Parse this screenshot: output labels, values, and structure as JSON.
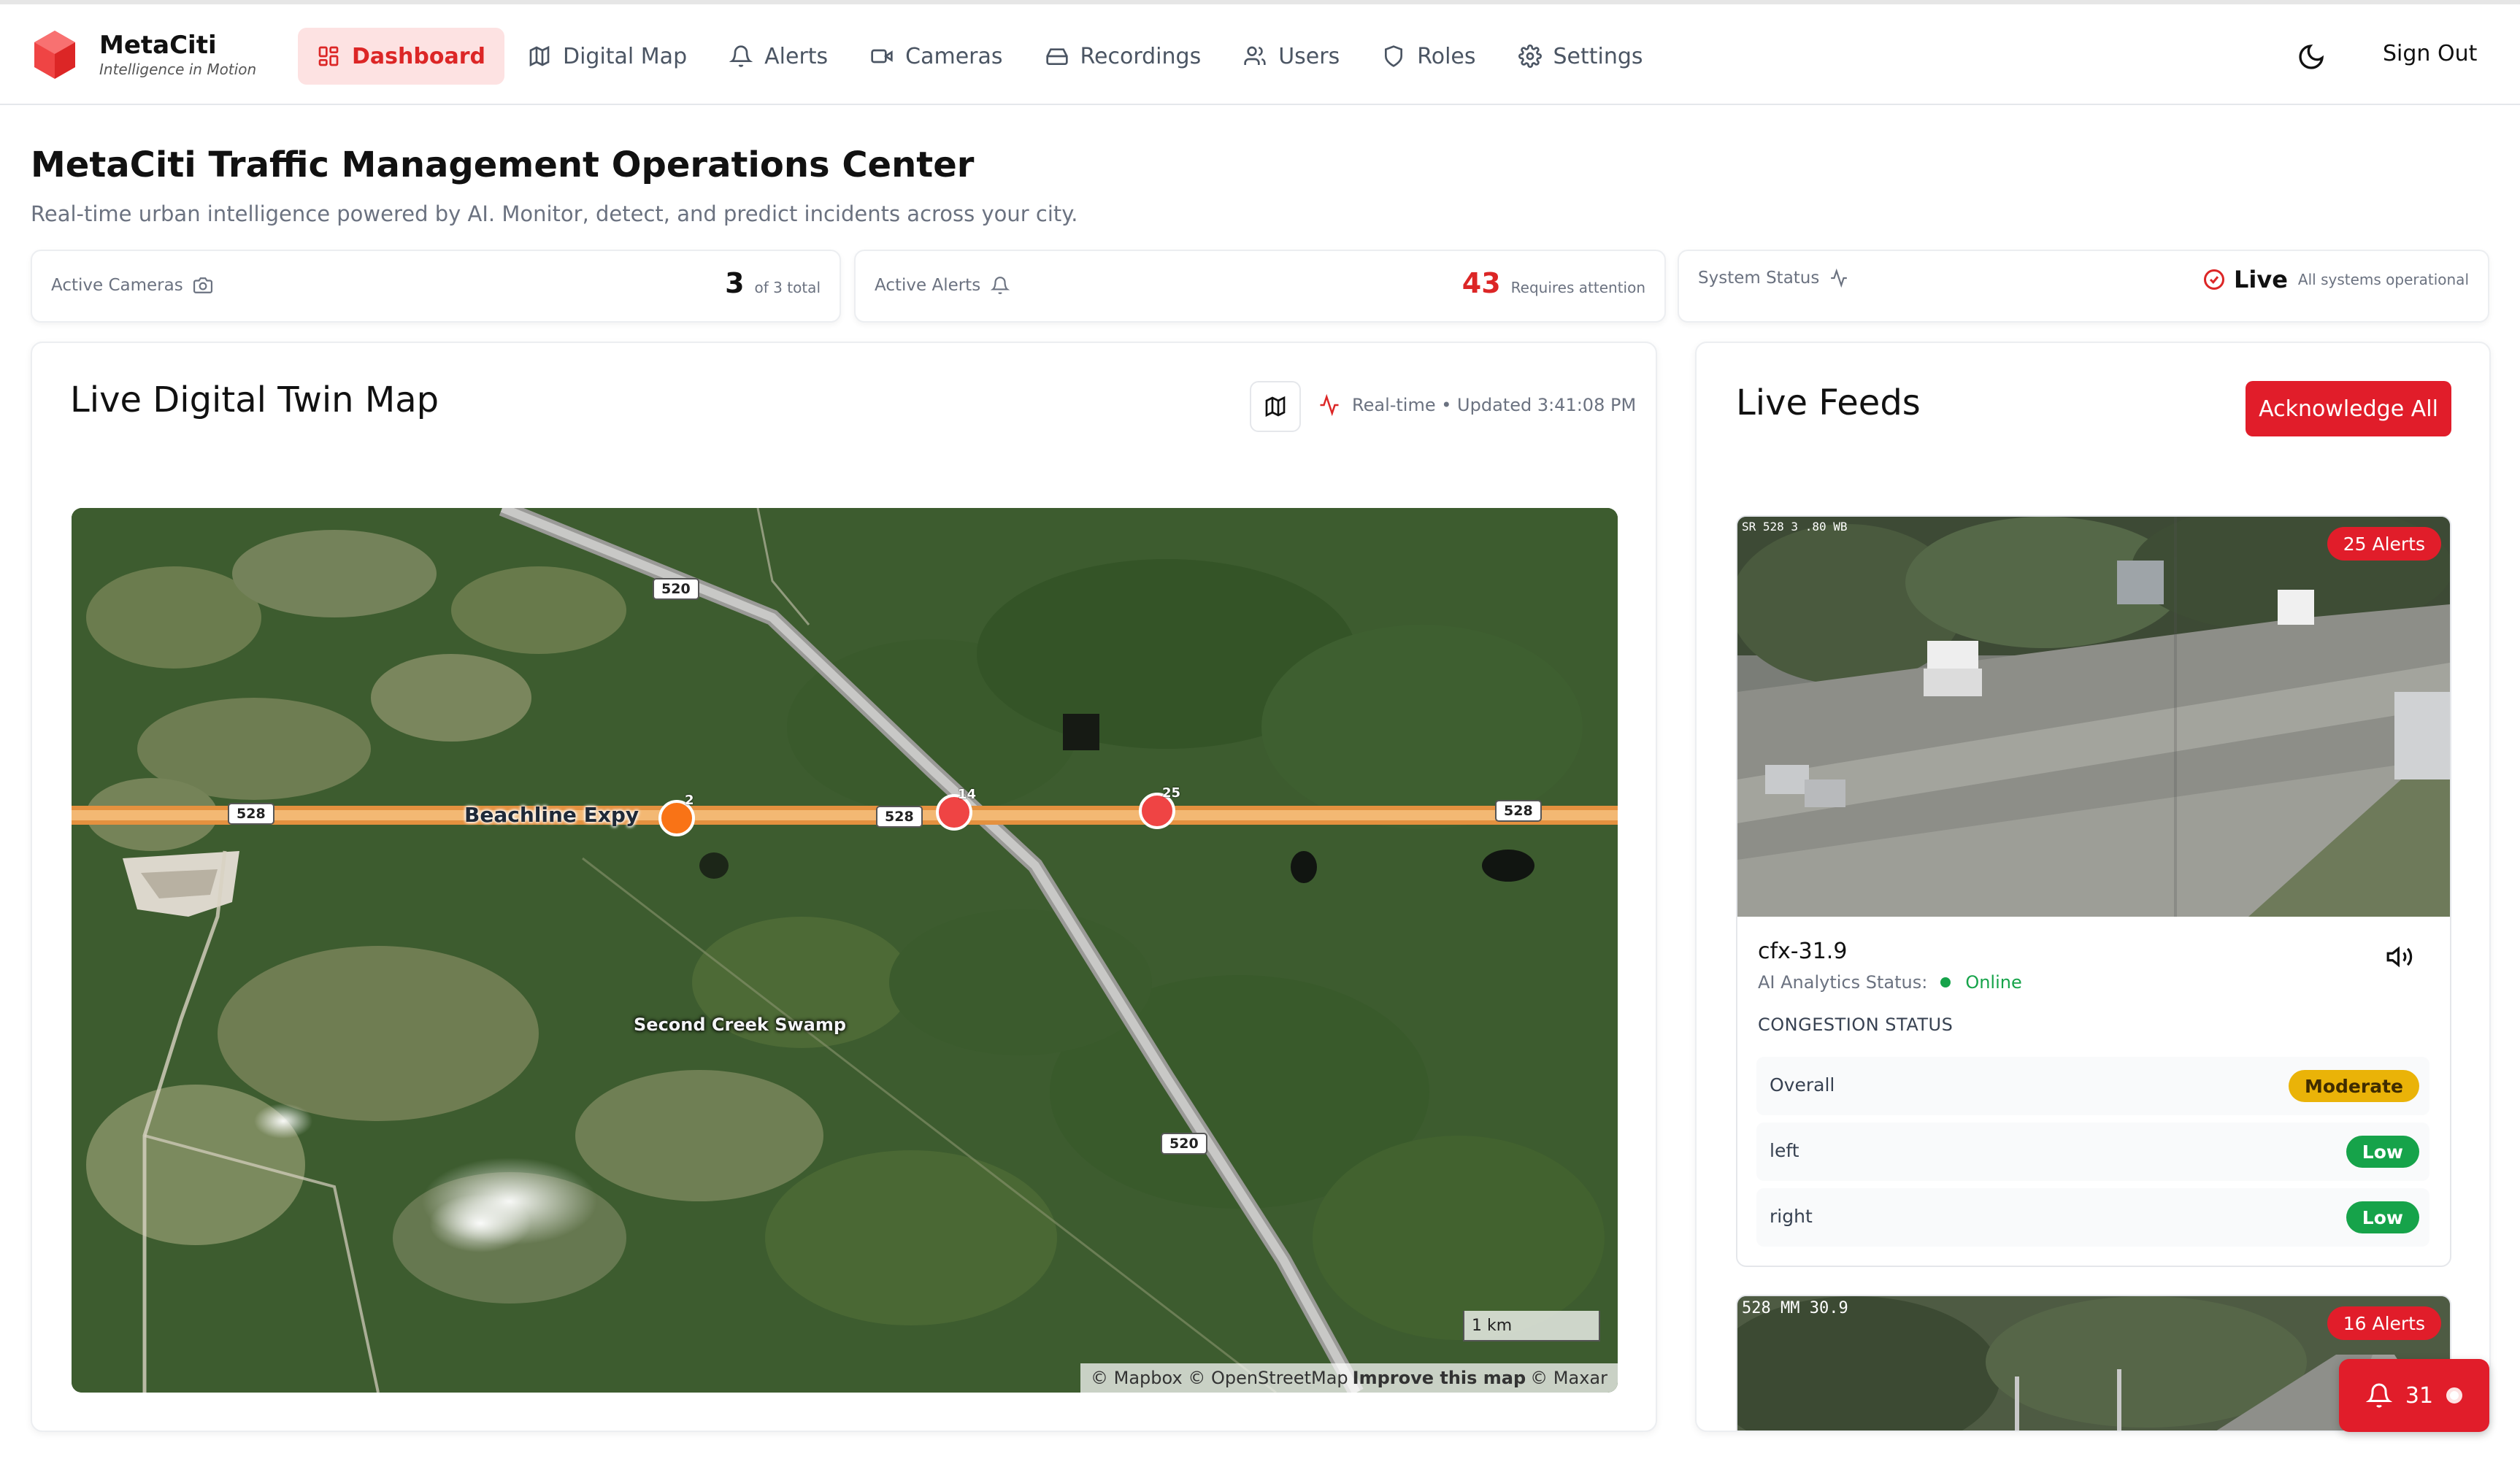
{
  "app": {
    "name": "MetaCiti",
    "tagline": "Intelligence in Motion",
    "brand_color": "#dc2626"
  },
  "nav": {
    "items": [
      {
        "label": "Dashboard",
        "icon": "dashboard-icon",
        "active": true
      },
      {
        "label": "Digital Map",
        "icon": "map-icon"
      },
      {
        "label": "Alerts",
        "icon": "bell-icon"
      },
      {
        "label": "Cameras",
        "icon": "video-icon"
      },
      {
        "label": "Recordings",
        "icon": "hard-drive-icon"
      },
      {
        "label": "Users",
        "icon": "users-icon"
      },
      {
        "label": "Roles",
        "icon": "shield-icon"
      },
      {
        "label": "Settings",
        "icon": "gear-icon"
      }
    ],
    "theme_icon": "moon-icon",
    "sign_out": "Sign Out"
  },
  "header": {
    "title": "MetaCiti Traffic Management Operations Center",
    "subtitle": "Real-time urban intelligence powered by AI. Monitor, detect, and predict incidents across your city."
  },
  "stats": {
    "cameras": {
      "label": "Active Cameras",
      "value": "3",
      "sub": "of 3 total"
    },
    "alerts": {
      "label": "Active Alerts",
      "value": "43",
      "sub": "Requires attention"
    },
    "system": {
      "label": "System Status",
      "value": "Live",
      "sub": "All systems operational"
    }
  },
  "map": {
    "title": "Live Digital Twin Map",
    "status": "Real-time • Updated 3:41:08 PM",
    "road_name": "Beachline Expy",
    "place_name": "Second Creek Swamp",
    "route_shields": [
      "528",
      "528",
      "528",
      "520",
      "520"
    ],
    "markers": [
      {
        "count": "2",
        "color": "#f97316"
      },
      {
        "count": "14",
        "color": "#ef4444"
      },
      {
        "count": "25",
        "color": "#ef4444"
      }
    ],
    "scale": "1 km",
    "attribution": {
      "mapbox": "© Mapbox",
      "osm": "© OpenStreetMap",
      "improve": "Improve this map",
      "maxar": "© Maxar"
    }
  },
  "feeds": {
    "title": "Live Feeds",
    "acknowledge_all": "Acknowledge All",
    "items": [
      {
        "overlay": "SR 528 3 .80 WB",
        "alerts": "25 Alerts",
        "name": "cfx-31.9",
        "analytics_label": "AI Analytics Status:",
        "analytics_status": "Online",
        "congestion_title": "CONGESTION STATUS",
        "rows": [
          {
            "label": "Overall",
            "status": "Moderate"
          },
          {
            "label": "left",
            "status": "Low"
          },
          {
            "label": "right",
            "status": "Low"
          }
        ]
      },
      {
        "overlay": "528 MM 30.9",
        "alerts": "16 Alerts"
      }
    ]
  },
  "notifications": {
    "count": "31"
  }
}
